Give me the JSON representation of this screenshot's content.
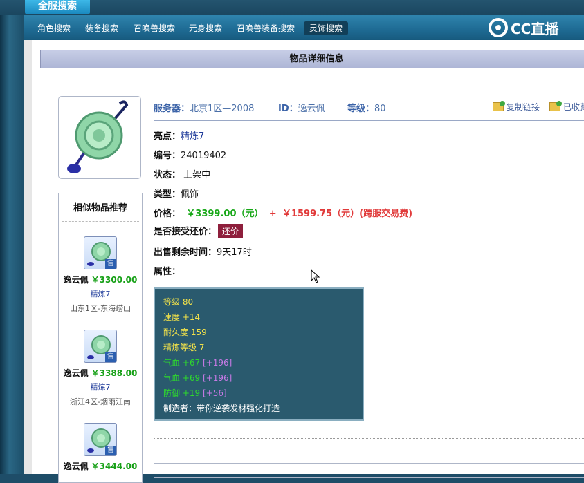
{
  "top_tab": "全服搜索",
  "nav": {
    "items": [
      "角色搜索",
      "装备搜索",
      "召唤兽搜索",
      "元身搜索",
      "召唤兽装备搜索",
      "灵饰搜索"
    ],
    "active_index": 5,
    "logo_text": "CC直播"
  },
  "panel_title": "物品详细信息",
  "item": {
    "server_label": "服务器：",
    "server_value": "北京1区—2008",
    "id_label": "ID：",
    "id_value": "逸云佩",
    "level_label": "等级：",
    "level_value": "80",
    "copy_link": "复制链接",
    "favorited": "已收藏",
    "highlight_label": "亮点：",
    "highlight_value": "精炼7",
    "number_label": "编号：",
    "number_value": "24019402",
    "status_label": "状态：",
    "status_value": "上架中",
    "type_label": "类型：",
    "type_value": "佩饰",
    "price_label": "价格：",
    "price_main": "￥3399.00（元）",
    "price_plus": "+",
    "price_fee": "￥1599.75（元）(跨服交易费)",
    "counter_label": "是否接受还价：",
    "counter_button": "还价",
    "remain_label": "出售剩余时间：",
    "remain_value": "9天17时",
    "attr_label": "属性："
  },
  "attributes": [
    {
      "text": "等级 80",
      "color": "yellow"
    },
    {
      "text": "速度 +14",
      "color": "yellow"
    },
    {
      "text": "耐久度 159",
      "color": "yellow"
    },
    {
      "text": "精炼等级 7",
      "color": "yellow"
    },
    {
      "text": "气血 +67",
      "extra": "[+196]",
      "color": "green"
    },
    {
      "text": "气血 +69",
      "extra": "[+196]",
      "color": "green"
    },
    {
      "text": "防御 +19",
      "extra": "[+56]",
      "color": "green"
    },
    {
      "text": "制造者：带你逆袭发材强化打造",
      "color": "white"
    }
  ],
  "similar": {
    "title": "相似物品推荐",
    "sale_badge": "售",
    "items": [
      {
        "name": "逸云佩",
        "price": "￥3300.00",
        "refine": "精炼7",
        "server": "山东1区-东海崂山"
      },
      {
        "name": "逸云佩",
        "price": "￥3388.00",
        "refine": "精炼7",
        "server": "浙江4区-烟雨江南"
      },
      {
        "name": "逸云佩",
        "price": "￥3444.00",
        "refine": "",
        "server": ""
      }
    ]
  },
  "colors": {
    "nav_bg": "#1f6c95",
    "price_red": "#e13a3a",
    "price_green": "#18a818",
    "counter_btn": "#8e1f3c",
    "attr_bg": "#2a5a6e"
  }
}
